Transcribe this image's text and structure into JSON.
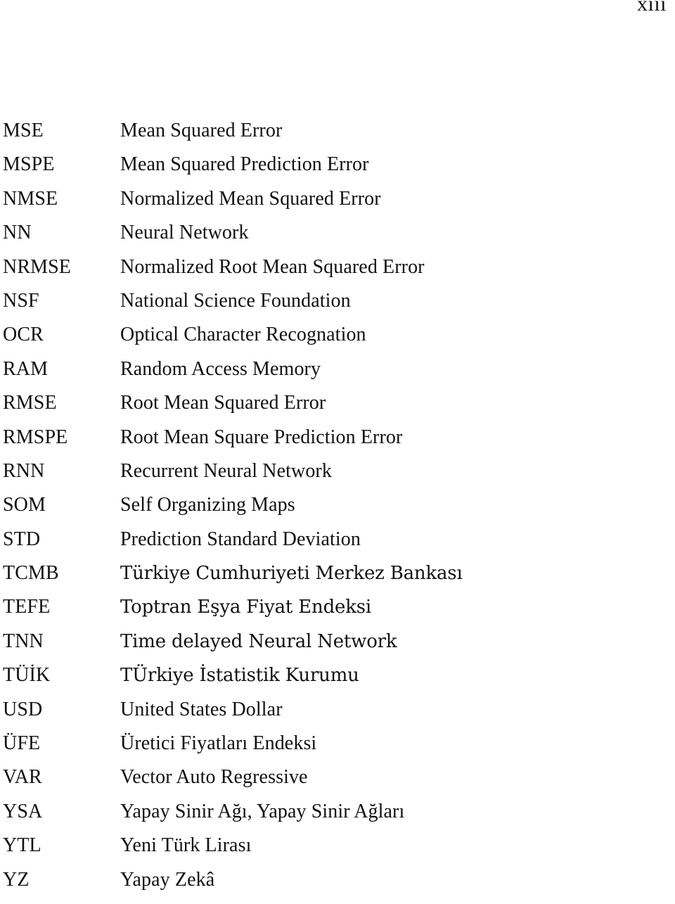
{
  "page": {
    "folio": "xiii",
    "background_color": "#ffffff",
    "text_color": "#111111"
  },
  "abbreviations": [
    {
      "term": "MSE",
      "definition": "Mean Squared Error",
      "script": "latin"
    },
    {
      "term": "MSPE",
      "definition": "Mean Squared Prediction Error",
      "script": "latin"
    },
    {
      "term": "NMSE",
      "definition": "Normalized Mean Squared Error",
      "script": "latin"
    },
    {
      "term": "NN",
      "definition": "Neural Network",
      "script": "latin"
    },
    {
      "term": "NRMSE",
      "definition": "Normalized Root Mean Squared Error",
      "script": "latin"
    },
    {
      "term": "NSF",
      "definition": "National Science Foundation",
      "script": "latin"
    },
    {
      "term": "OCR",
      "definition": "Optical Character Recognation",
      "script": "latin"
    },
    {
      "term": "RAM",
      "definition": "Random Access Memory",
      "script": "latin"
    },
    {
      "term": "RMSE",
      "definition": "Root Mean Squared Error",
      "script": "latin"
    },
    {
      "term": "RMSPE",
      "definition": "Root Mean Square Prediction Error",
      "script": "latin"
    },
    {
      "term": "RNN",
      "definition": "Recurrent Neural Network",
      "script": "latin"
    },
    {
      "term": "SOM",
      "definition": "Self Organizing Maps",
      "script": "latin"
    },
    {
      "term": "STD",
      "definition": "Prediction Standard Deviation",
      "script": "latin"
    },
    {
      "term": "TCMB",
      "definition": "Türkiye Cumhuriyeti Merkez Bankası",
      "script": "turkish"
    },
    {
      "term": "TEFE",
      "definition": "Toptran Eşya Fiyat Endeksi",
      "script": "turkish"
    },
    {
      "term": "TNN",
      "definition": "Time delayed Neural Network",
      "script": "turkish"
    },
    {
      "term": "TÜİK",
      "definition": "TÜrkiye İstatistik Kurumu",
      "script": "turkish"
    },
    {
      "term": "USD",
      "definition": "United States Dollar",
      "script": "latin"
    },
    {
      "term": "ÜFE",
      "definition": "Üretici Fiyatları Endeksi",
      "script": "latin"
    },
    {
      "term": "VAR",
      "definition": "Vector Auto Regressive",
      "script": "latin"
    },
    {
      "term": "YSA",
      "definition": "Yapay Sinir Ağı, Yapay Sinir Ağları",
      "script": "latin"
    },
    {
      "term": "YTL",
      "definition": "Yeni Türk Lirası",
      "script": "latin"
    },
    {
      "term": "YZ",
      "definition": "Yapay Zekâ",
      "script": "latin"
    }
  ]
}
